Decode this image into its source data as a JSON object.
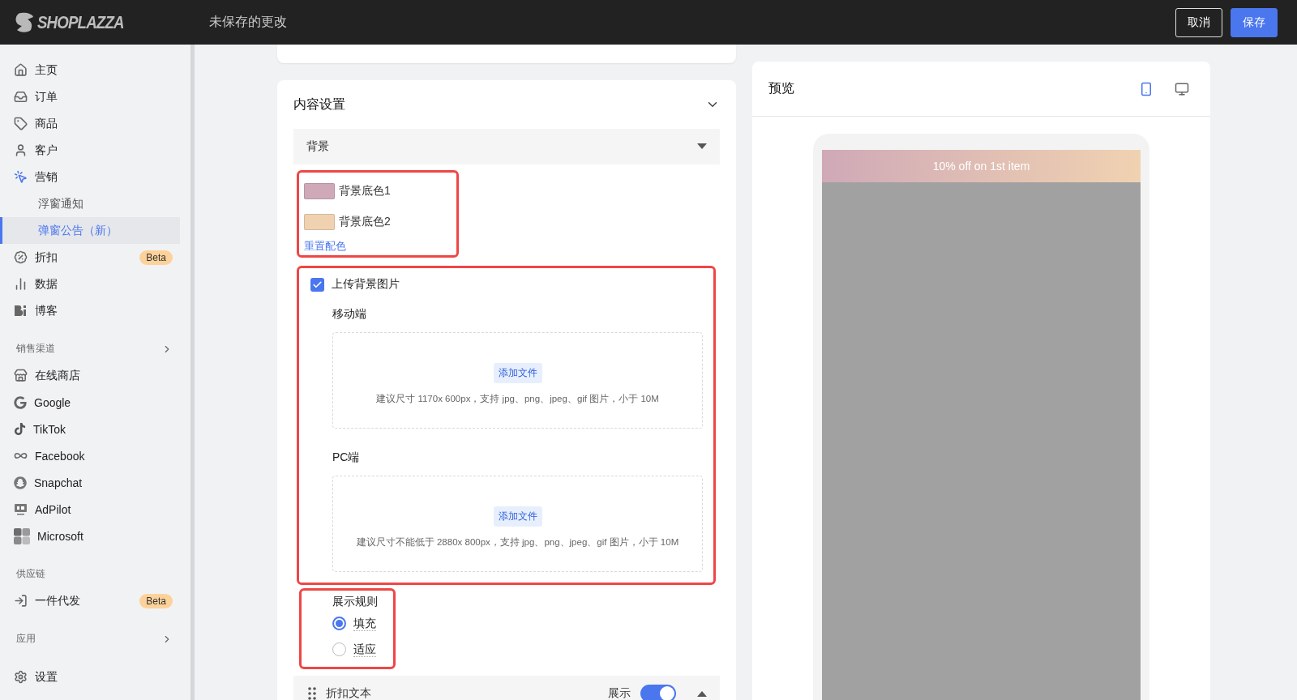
{
  "topbar": {
    "logo": "SHOPLAZZA",
    "title": "未保存的更改",
    "buttons": [
      {
        "label": "取消",
        "kind": "secondary"
      },
      {
        "label": "保存",
        "kind": "primary"
      }
    ]
  },
  "sidebar": {
    "sections": [
      {
        "items": [
          {
            "label": "主页",
            "selected": false
          },
          {
            "label": "订单",
            "selected": false
          },
          {
            "label": "商品",
            "selected": false
          },
          {
            "label": "客户",
            "selected": false
          },
          {
            "label": "营销",
            "selected": false,
            "expanded": true,
            "children": [
              {
                "label": "浮窗通知",
                "selected": false
              },
              {
                "label": "弹窗公告（新）",
                "selected": true
              }
            ]
          },
          {
            "label": "折扣",
            "selected": false,
            "badge": "Beta"
          },
          {
            "label": "数据",
            "selected": false
          },
          {
            "label": "博客",
            "selected": false
          }
        ]
      },
      {
        "heading": "销售渠道",
        "arrow": true,
        "items": [
          {
            "label": "在线商店",
            "selected": false
          },
          {
            "label": "Google",
            "selected": false
          },
          {
            "label": "TikTok",
            "selected": false
          },
          {
            "label": "Facebook",
            "selected": false
          },
          {
            "label": "Snapchat",
            "selected": false
          },
          {
            "label": "AdPilot",
            "selected": false
          },
          {
            "label": "Microsoft",
            "selected": false
          }
        ]
      },
      {
        "heading": "供应链",
        "arrow": false,
        "items": [
          {
            "label": "一件代发",
            "selected": false,
            "badge": "Beta"
          }
        ]
      },
      {
        "heading": "应用",
        "arrow": true
      },
      {
        "items": [
          {
            "label": "设置",
            "selected": false
          }
        ]
      }
    ]
  },
  "content_card": {
    "title": "内容设置",
    "expanded": true,
    "sections": [
      {
        "title": "背景",
        "expanded": true,
        "colors": {
          "highlighted": true,
          "swatches": [
            {
              "label": "背景底色1",
              "color": "#cfa9b7"
            },
            {
              "label": "背景底色2",
              "color": "#f0d2b1"
            }
          ],
          "reset_link": "重置配色"
        },
        "upload": {
          "highlighted": true,
          "checkbox": {
            "label": "上传背景图片",
            "checked": true
          },
          "slots": [
            {
              "label": "移动端",
              "button": "添加文件",
              "hint": "建议尺寸 1170x 600px，支持 jpg、png、jpeg、gif 图片，小于 10M"
            },
            {
              "label": "PC端",
              "button": "添加文件",
              "hint": "建议尺寸不能低于 2880x 800px，支持 jpg、png、jpeg、gif 图片，小于 10M"
            }
          ]
        },
        "display_rule": {
          "highlighted": true,
          "label": "展示规则",
          "options": [
            {
              "label": "填充",
              "selected": true
            },
            {
              "label": "适应",
              "selected": false
            }
          ]
        }
      },
      {
        "title": "折扣文本",
        "expanded": false,
        "toggle": {
          "label": "展示",
          "on": true
        }
      }
    ]
  },
  "preview": {
    "title": "预览",
    "devices": [
      {
        "kind": "mobile",
        "selected": true
      },
      {
        "kind": "desktop",
        "selected": false
      }
    ],
    "banner": "10% off on 1st item"
  }
}
